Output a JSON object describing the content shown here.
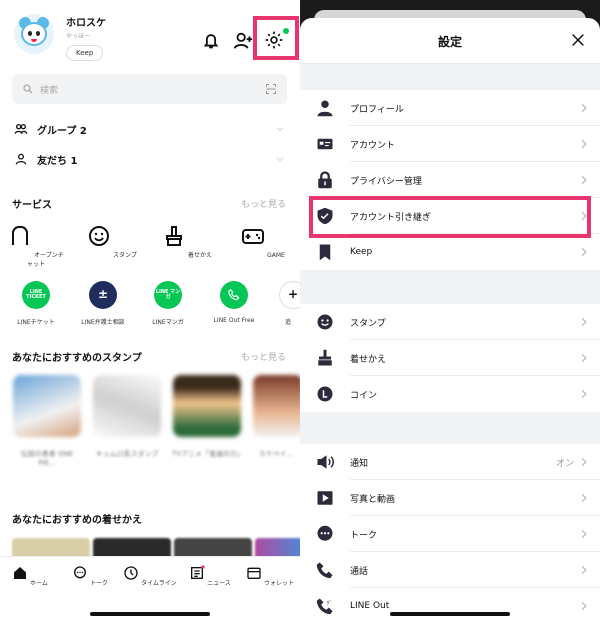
{
  "home": {
    "profile": {
      "name": "ホロスケ",
      "status": "やっほー",
      "keep_label": "Keep"
    },
    "search_placeholder": "検索",
    "groups": {
      "label": "グループ 2"
    },
    "friends": {
      "label": "友だち 1"
    },
    "services": {
      "title": "サービス",
      "more": "もっと見る",
      "items": [
        "オープンチャット",
        "スタンプ",
        "着せかえ",
        "GAME"
      ]
    },
    "apps": [
      {
        "label": "LINEチケット",
        "badge": "LINE TICKET",
        "color": "#06c755"
      },
      {
        "label": "LINE弁護士相談",
        "badge": "±",
        "color": "#1f2c5c"
      },
      {
        "label": "LINEマンガ",
        "badge": "LINE マンガ",
        "color": "#06c755"
      },
      {
        "label": "LINE Out Free",
        "badge": "",
        "color": "#06c755"
      },
      {
        "label": "追",
        "badge": "+",
        "color": "#ffffff"
      }
    ],
    "stickers": {
      "title": "あなたにおすすめのスタンプ",
      "more": "もっと見る",
      "items": [
        "伝説の勇者 ONE PIE...",
        "キュムロ系スタンプ",
        "TVアニメ「鬼滅の刃」",
        "スケベイ..."
      ]
    },
    "themes": {
      "title": "あなたにおすすめの着せかえ"
    },
    "tabs": [
      "ホーム",
      "トーク",
      "タイムライン",
      "ニュース",
      "ウォレット"
    ]
  },
  "settings": {
    "title": "設定",
    "rows_group1": [
      {
        "icon": "person-icon",
        "label": "プロフィール"
      },
      {
        "icon": "id-card-icon",
        "label": "アカウント"
      },
      {
        "icon": "lock-icon",
        "label": "プライバシー管理"
      },
      {
        "icon": "shield-icon",
        "label": "アカウント引き継ぎ"
      },
      {
        "icon": "bookmark-icon",
        "label": "Keep"
      }
    ],
    "rows_group2": [
      {
        "icon": "smile-icon",
        "label": "スタンプ"
      },
      {
        "icon": "brush-icon",
        "label": "着せかえ"
      },
      {
        "icon": "coin-icon",
        "label": "コイン"
      }
    ],
    "rows_group3": [
      {
        "icon": "speaker-icon",
        "label": "通知",
        "value": "オン"
      },
      {
        "icon": "play-icon",
        "label": "写真と動画"
      },
      {
        "icon": "chat-icon",
        "label": "トーク"
      },
      {
        "icon": "phone-icon",
        "label": "通話"
      },
      {
        "icon": "phone-out-icon",
        "label": "LINE Out"
      }
    ]
  },
  "colors": {
    "accent_highlight": "#e8356d",
    "line_green": "#06c755"
  }
}
